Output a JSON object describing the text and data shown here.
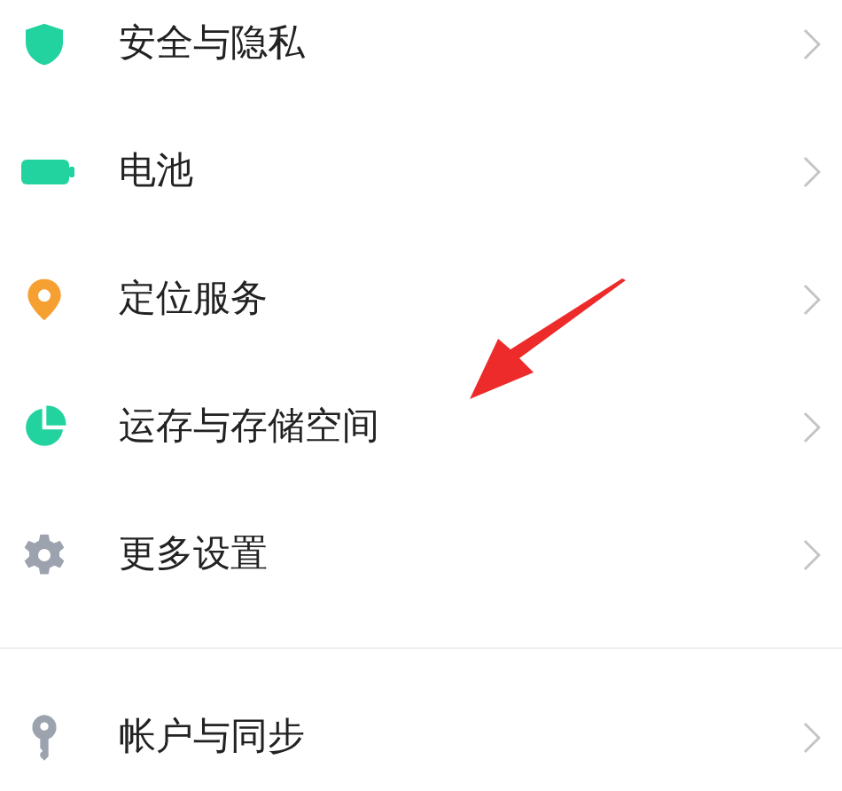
{
  "groups": [
    {
      "items": [
        {
          "label": "安全与隐私"
        },
        {
          "label": "电池"
        },
        {
          "label": "定位服务"
        },
        {
          "label": "运存与存储空间"
        },
        {
          "label": "更多设置"
        }
      ]
    },
    {
      "items": [
        {
          "label": "帐户与同步"
        }
      ]
    }
  ]
}
